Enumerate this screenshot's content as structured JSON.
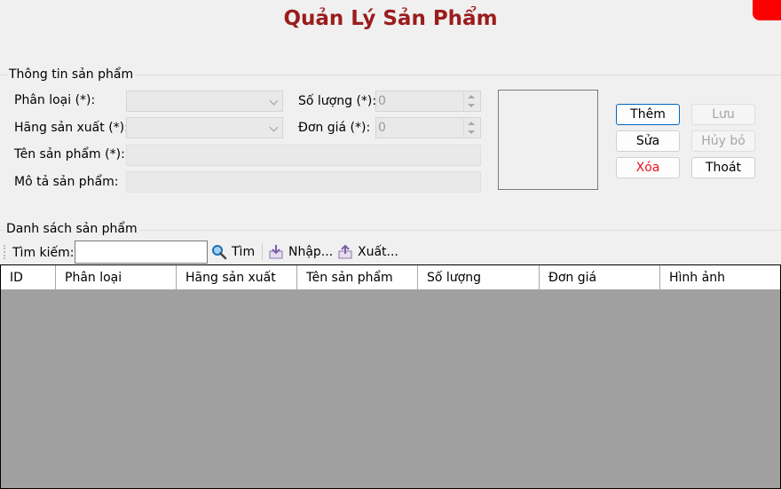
{
  "title": "Quản Lý Sản Phẩm",
  "product_info": {
    "group_label": "Thông tin sản phẩm",
    "category_label": "Phân loại (*):",
    "manufacturer_label": "Hãng sản xuất (*):",
    "name_label": "Tên sản phẩm (*):",
    "description_label": "Mô tả sản phẩm:",
    "quantity_label": "Số lượng (*):",
    "quantity_value": "0",
    "price_label": "Đơn giá (*):",
    "price_value": "0"
  },
  "buttons": {
    "add": "Thêm",
    "save": "Lưu",
    "edit": "Sửa",
    "cancel": "Hủy bỏ",
    "delete": "Xóa",
    "exit": "Thoát"
  },
  "colors": {
    "title": "#9b1c1c",
    "delete_text": "#e81123",
    "grid_background": "#a0a0a0"
  },
  "product_list": {
    "group_label": "Danh sách sản phẩm",
    "search_label": "Tìm kiếm:",
    "search_value": "",
    "search_button": "Tìm",
    "import_button": "Nhập...",
    "export_button": "Xuất...",
    "columns": [
      "ID",
      "Phân loại",
      "Hãng sản xuất",
      "Tên sản phẩm",
      "Số lượng",
      "Đơn giá",
      "Hình ảnh"
    ],
    "rows": []
  },
  "icons": {
    "search": "magnifier-icon",
    "import": "import-icon",
    "export": "export-icon"
  }
}
